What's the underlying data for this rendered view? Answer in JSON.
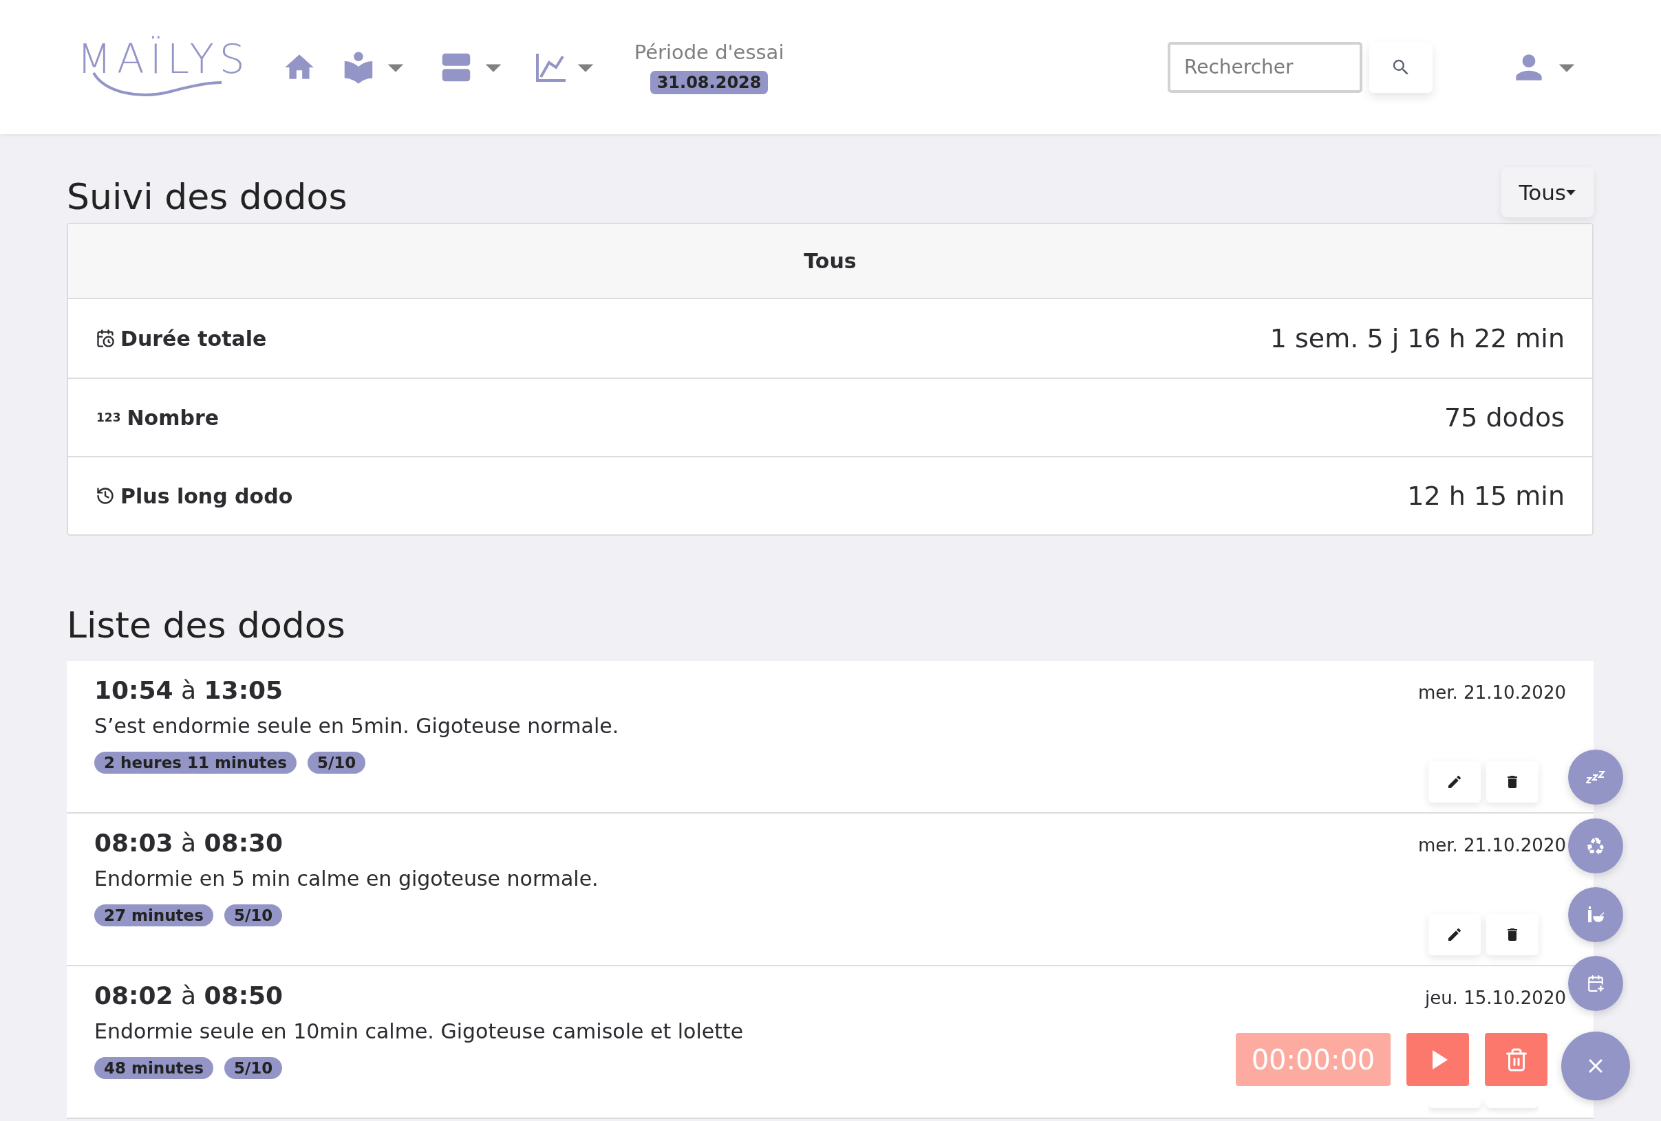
{
  "logo": "MAÏLYS",
  "nav": [
    {
      "kind": "home",
      "dropdown": false
    },
    {
      "kind": "reader",
      "dropdown": true
    },
    {
      "kind": "rows",
      "dropdown": true
    },
    {
      "kind": "chart",
      "dropdown": true
    }
  ],
  "trial": {
    "label": "Période d'essai",
    "date": "31.08.2028"
  },
  "search": {
    "placeholder": "Rechercher"
  },
  "page_title": "Suivi des dodos",
  "filter_button": "Tous",
  "stats": {
    "heading": "Tous",
    "rows": [
      {
        "kind": "duration",
        "label": "Durée totale",
        "value": "1 sem. 5 j 16 h 22 min"
      },
      {
        "kind": "count",
        "glyph": "123",
        "label": "Nombre",
        "value": "75 dodos"
      },
      {
        "kind": "longest",
        "label": "Plus long dodo",
        "value": "12 h 15 min"
      }
    ]
  },
  "list_title": "Liste des dodos",
  "entries": [
    {
      "start": "10:54",
      "separator": "à",
      "end": "13:05",
      "date": "mer. 21.10.2020",
      "note": "S’est endormie seule en 5min. Gigoteuse normale.",
      "tags": [
        "2 heures 11 minutes",
        "5/10"
      ]
    },
    {
      "start": "08:03",
      "separator": "à",
      "end": "08:30",
      "date": "mer. 21.10.2020",
      "note": "Endormie en 5 min calme en gigoteuse normale.",
      "tags": [
        "27 minutes",
        "5/10"
      ]
    },
    {
      "start": "08:02",
      "separator": "à",
      "end": "08:50",
      "date": "jeu. 15.10.2020",
      "note": "Endormie seule en 10min calme. Gigoteuse camisole et lolette",
      "tags": [
        "48 minutes",
        "5/10"
      ]
    }
  ],
  "timer": {
    "display": "00:00:00"
  },
  "fab_actions": [
    {
      "kind": "sleep"
    },
    {
      "kind": "recycle"
    },
    {
      "kind": "bottle"
    },
    {
      "kind": "calendar"
    }
  ]
}
